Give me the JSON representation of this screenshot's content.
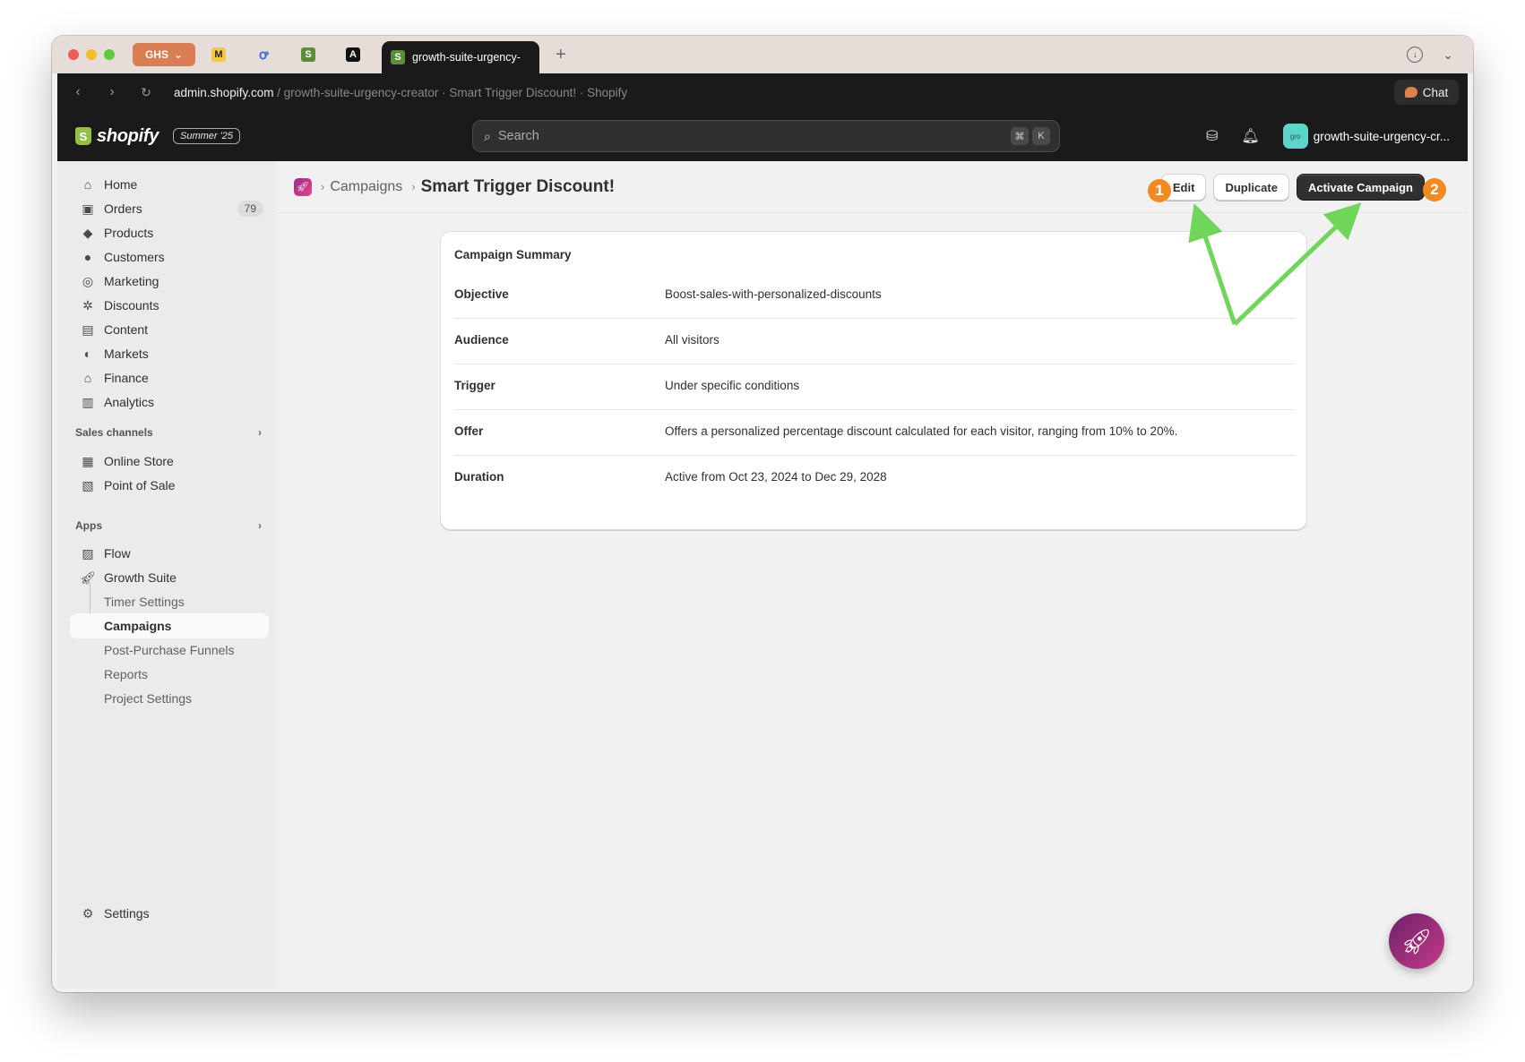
{
  "browser": {
    "group_label": "GHS",
    "pinned_tabs": [
      {
        "icon": "m-icon",
        "glyph": "M"
      },
      {
        "icon": "o-icon",
        "glyph": "ꝍ"
      },
      {
        "icon": "shopify-bag-icon",
        "glyph": "S"
      },
      {
        "icon": "a-icon",
        "glyph": "A"
      }
    ],
    "active_tab_title": "growth-suite-urgency-",
    "url_host": "admin.shopify.com",
    "url_rest": " / growth-suite-urgency-creator · Smart Trigger Discount! · Shopify",
    "chat_label": "Chat"
  },
  "header": {
    "logo_text": "shopify",
    "edition_badge": "Summer '25",
    "search_placeholder": "Search",
    "shortcut_keys": [
      "⌘",
      "K"
    ],
    "store_avatar_text": "gro",
    "store_name": "growth-suite-urgency-cr..."
  },
  "sidebar": {
    "main_items": [
      {
        "label": "Home",
        "icon": "home-icon"
      },
      {
        "label": "Orders",
        "icon": "orders-icon",
        "count": "79"
      },
      {
        "label": "Products",
        "icon": "tag-icon"
      },
      {
        "label": "Customers",
        "icon": "person-icon"
      },
      {
        "label": "Marketing",
        "icon": "target-icon"
      },
      {
        "label": "Discounts",
        "icon": "discount-icon"
      },
      {
        "label": "Content",
        "icon": "content-icon"
      },
      {
        "label": "Markets",
        "icon": "globe-icon"
      },
      {
        "label": "Finance",
        "icon": "bank-icon"
      },
      {
        "label": "Analytics",
        "icon": "bar-chart-icon"
      }
    ],
    "sales_channels_heading": "Sales channels",
    "sales_channels": [
      {
        "label": "Online Store",
        "icon": "store-icon"
      },
      {
        "label": "Point of Sale",
        "icon": "pos-icon"
      }
    ],
    "apps_heading": "Apps",
    "apps": [
      {
        "label": "Flow",
        "icon": "flow-icon"
      },
      {
        "label": "Growth Suite",
        "icon": "rocket-icon"
      }
    ],
    "growth_suite_sub": [
      "Timer Settings",
      "Campaigns",
      "Post-Purchase Funnels",
      "Reports",
      "Project Settings"
    ],
    "active_sub": "Campaigns",
    "settings_label": "Settings"
  },
  "page": {
    "breadcrumb": "Campaigns",
    "title": "Smart Trigger Discount!",
    "actions": {
      "edit": "Edit",
      "duplicate": "Duplicate",
      "activate": "Activate Campaign"
    },
    "step_markers": [
      "1",
      "2"
    ],
    "summary": {
      "title": "Campaign Summary",
      "rows": [
        {
          "key": "Objective",
          "value": "Boost-sales-with-personalized-discounts"
        },
        {
          "key": "Audience",
          "value": "All visitors"
        },
        {
          "key": "Trigger",
          "value": "Under specific conditions"
        },
        {
          "key": "Offer",
          "value": "Offers a personalized percentage discount calculated for each visitor, ranging from 10% to 20%."
        },
        {
          "key": "Duration",
          "value": "Active from Oct 23, 2024 to Dec 29, 2028"
        }
      ]
    }
  },
  "colors": {
    "annotation_arrow": "#6fd65a",
    "step_marker": "#f18a21",
    "primary_button": "#303030"
  }
}
